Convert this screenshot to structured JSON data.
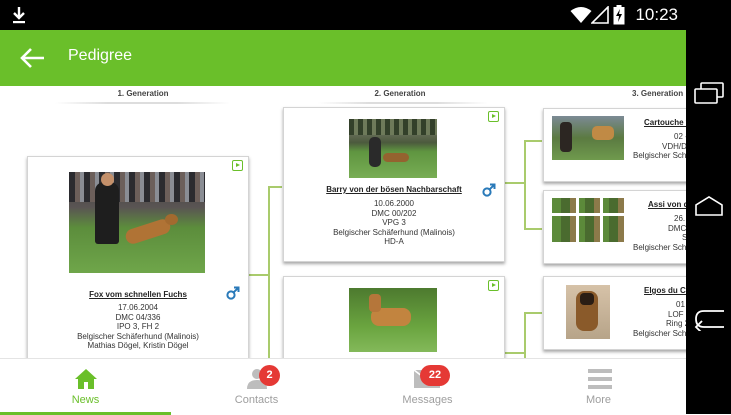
{
  "status_bar": {
    "time": "10:23"
  },
  "app_bar": {
    "title": "Pedigree"
  },
  "generations": [
    "1. Generation",
    "2. Generation",
    "3. Generation"
  ],
  "gen1": {
    "name": "Fox vom schnellen Fuchs",
    "lines": [
      "17.06.2004",
      "DMC 04/336",
      "IPO 3, FH 2",
      "Belgischer Schäferhund (Malinois)",
      "Mathias Dögel, Kristin Dögel"
    ]
  },
  "gen2": [
    {
      "name": "Barry von der bösen Nachbarschaft",
      "lines": [
        "10.06.2000",
        "DMC 00/202",
        "VPG 3",
        "Belgischer Schäferhund (Malinois)",
        "HD-A"
      ]
    },
    {
      "name": "",
      "lines": []
    }
  ],
  "gen3": [
    {
      "name": "Cartouche v",
      "lines": [
        "02 -",
        "VDH/D",
        "",
        "Belgischer Schä"
      ]
    },
    {
      "name": "Assi von de",
      "lines": [
        "26.",
        "DMC",
        "S",
        "Belgischer Schä"
      ]
    },
    {
      "name": "Elgos du Ch",
      "lines": [
        "01",
        "LOF 1",
        "Ring 2",
        "Belgischer Schä"
      ]
    }
  ],
  "bottom_nav": [
    {
      "label": "News",
      "active": true
    },
    {
      "label": "Contacts",
      "badge": "2"
    },
    {
      "label": "Messages",
      "badge": "22"
    },
    {
      "label": "More"
    }
  ],
  "colors": {
    "primary": "#6abf2a",
    "badge": "#e53935",
    "male": "#2a7ab9",
    "connector": "#a9cb6c"
  }
}
